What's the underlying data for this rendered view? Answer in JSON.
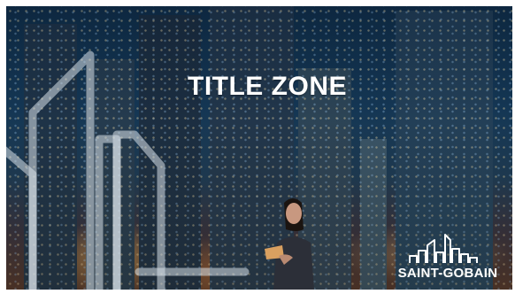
{
  "slide": {
    "title": "TITLE ZONE"
  },
  "logo": {
    "text": "SAINT-GOBAIN",
    "icon": "city-skyline-logo-icon"
  },
  "decor": {
    "line_art": "building-outline-line-art",
    "background": "night-city-skyline-photo",
    "person": "woman-holding-tablet"
  },
  "colors": {
    "title": "#ffffff",
    "line_art": "#d8e2ea",
    "sky": "#143654"
  }
}
